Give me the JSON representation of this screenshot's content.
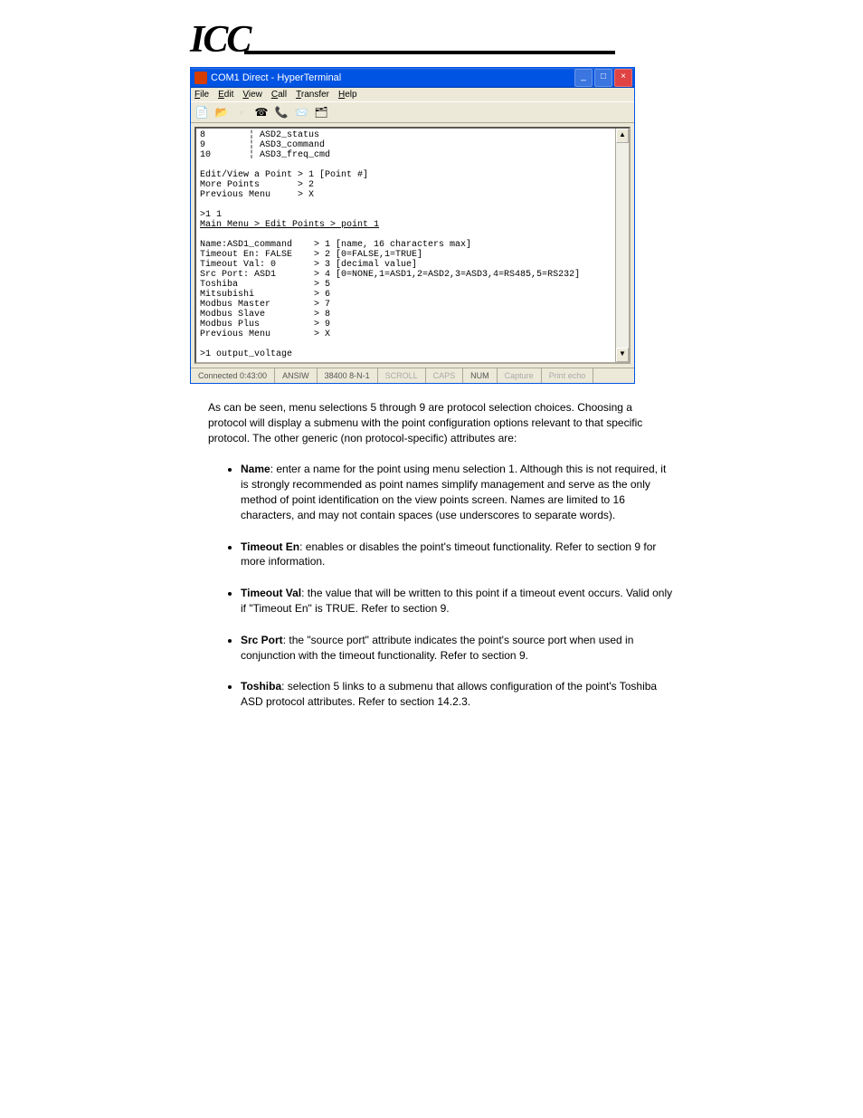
{
  "logo": "ICC",
  "window": {
    "title": "COM1 Direct - HyperTerminal",
    "menu": [
      "File",
      "Edit",
      "View",
      "Call",
      "Transfer",
      "Help"
    ]
  },
  "terminal": {
    "lines_plain_0": "8        ¦ ASD2_status\n9        ¦ ASD3_command\n10       ¦ ASD3_freq_cmd\n\nEdit/View a Point > 1 [Point #]\nMore Points       > 2\nPrevious Menu     > X\n\n>1 1\n",
    "breadcrumb": "Main Menu > Edit Points > point 1",
    "lines_plain_1": "\n\nName:ASD1_command    > 1 [name, 16 characters max]\nTimeout En: FALSE    > 2 [0=FALSE,1=TRUE]\nTimeout Val: 0       > 3 [decimal value]\nSrc Port: ASD1       > 4 [0=NONE,1=ASD1,2=ASD2,3=ASD3,4=RS485,5=RS232]\nToshiba              > 5\nMitsubishi           > 6\nModbus Master        > 7\nModbus Slave         > 8\nModbus Plus          > 9\nPrevious Menu        > X\n\n>1 output_voltage"
  },
  "statusbar": {
    "connected": "Connected 0:43:00",
    "mode": "ANSIW",
    "settings": "38400 8-N-1",
    "scroll": "SCROLL",
    "caps": "CAPS",
    "num": "NUM",
    "capture": "Capture",
    "printecho": "Print echo"
  },
  "body": {
    "intro": "As can be seen, menu selections 5 through 9 are protocol selection choices. Choosing a protocol will display a submenu with the point configuration options relevant to that specific protocol. The other generic (non protocol-specific) attributes are:",
    "bullets": [
      {
        "label": "Name",
        "text": ": enter a name for the point using menu selection 1. Although this is not required, it is strongly recommended as point names simplify management and serve as the only method of point identification on the view points screen. Names are limited to 16 characters, and may not contain spaces (use underscores to separate words)."
      },
      {
        "label": "Timeout En",
        "text": ": enables or disables the point's timeout functionality. Refer to section 9 for more information."
      },
      {
        "label": "Timeout Val",
        "text": ": the value that will be written to this point if a timeout event occurs. Valid only if \"Timeout En\" is TRUE. Refer to section 9."
      },
      {
        "label": "Src Port",
        "text": ": the \"source port\" attribute indicates the point's source port when used in conjunction with the timeout functionality. Refer to section 9."
      },
      {
        "label": "Toshiba",
        "text": ": selection 5 links to a submenu that allows configuration of the point's Toshiba ASD protocol attributes. Refer to section 14.2.3."
      }
    ]
  }
}
